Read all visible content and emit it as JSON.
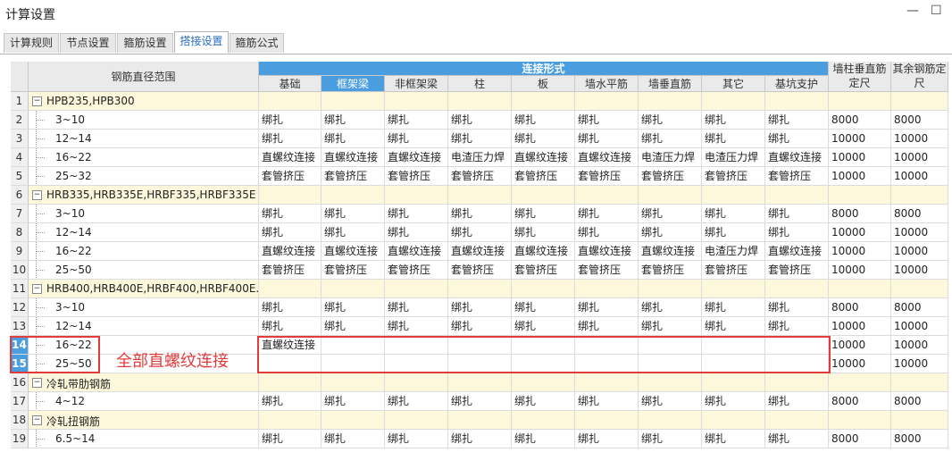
{
  "window": {
    "title": "计算设置",
    "minimize": "—",
    "maximize": "☐"
  },
  "tabs": [
    "计算规则",
    "节点设置",
    "箍筋设置",
    "搭接设置",
    "箍筋公式"
  ],
  "active_tab": 3,
  "header": {
    "range_label": "钢筋直径范围",
    "group_label": "连接形式",
    "columns": [
      "基础",
      "框架梁",
      "非框架梁",
      "柱",
      "板",
      "墙水平筋",
      "墙垂直筋",
      "其它",
      "基坑支护"
    ],
    "wall_col": "墙柱垂直筋定尺",
    "other_col": "其余钢筋定尺"
  },
  "rows": [
    {
      "num": "1",
      "group": true,
      "label": "HPB235,HPB300"
    },
    {
      "num": "2",
      "group": false,
      "label": "3~10",
      "cells": [
        "绑扎",
        "绑扎",
        "绑扎",
        "绑扎",
        "绑扎",
        "绑扎",
        "绑扎",
        "绑扎",
        "绑扎"
      ],
      "len1": "8000",
      "len2": "8000"
    },
    {
      "num": "3",
      "group": false,
      "label": "12~14",
      "cells": [
        "绑扎",
        "绑扎",
        "绑扎",
        "绑扎",
        "绑扎",
        "绑扎",
        "绑扎",
        "绑扎",
        "绑扎"
      ],
      "len1": "10000",
      "len2": "10000"
    },
    {
      "num": "4",
      "group": false,
      "label": "16~22",
      "cells": [
        "直螺纹连接",
        "直螺纹连接",
        "直螺纹连接",
        "电渣压力焊",
        "直螺纹连接",
        "直螺纹连接",
        "电渣压力焊",
        "电渣压力焊",
        "直螺纹连接"
      ],
      "len1": "10000",
      "len2": "10000"
    },
    {
      "num": "5",
      "group": false,
      "label": "25~32",
      "cells": [
        "套管挤压",
        "套管挤压",
        "套管挤压",
        "套管挤压",
        "套管挤压",
        "套管挤压",
        "套管挤压",
        "套管挤压",
        "套管挤压"
      ],
      "len1": "10000",
      "len2": "10000"
    },
    {
      "num": "6",
      "group": true,
      "label": "HRB335,HRB335E,HRBF335,HRBF335E"
    },
    {
      "num": "7",
      "group": false,
      "label": "3~10",
      "cells": [
        "绑扎",
        "绑扎",
        "绑扎",
        "绑扎",
        "绑扎",
        "绑扎",
        "绑扎",
        "绑扎",
        "绑扎"
      ],
      "len1": "8000",
      "len2": "8000"
    },
    {
      "num": "8",
      "group": false,
      "label": "12~14",
      "cells": [
        "绑扎",
        "绑扎",
        "绑扎",
        "绑扎",
        "绑扎",
        "绑扎",
        "绑扎",
        "绑扎",
        "绑扎"
      ],
      "len1": "10000",
      "len2": "10000"
    },
    {
      "num": "9",
      "group": false,
      "label": "16~22",
      "cells": [
        "直螺纹连接",
        "直螺纹连接",
        "直螺纹连接",
        "直螺纹连接",
        "直螺纹连接",
        "直螺纹连接",
        "直螺纹连接",
        "电渣压力焊",
        "直螺纹连接"
      ],
      "len1": "10000",
      "len2": "10000"
    },
    {
      "num": "10",
      "group": false,
      "label": "25~50",
      "cells": [
        "套管挤压",
        "套管挤压",
        "套管挤压",
        "套管挤压",
        "套管挤压",
        "套管挤压",
        "套管挤压",
        "套管挤压",
        "套管挤压"
      ],
      "len1": "10000",
      "len2": "10000"
    },
    {
      "num": "11",
      "group": true,
      "label": "HRB400,HRB400E,HRBF400,HRBF400E..."
    },
    {
      "num": "12",
      "group": false,
      "label": "3~10",
      "cells": [
        "绑扎",
        "绑扎",
        "绑扎",
        "绑扎",
        "绑扎",
        "绑扎",
        "绑扎",
        "绑扎",
        "绑扎"
      ],
      "len1": "8000",
      "len2": "8000"
    },
    {
      "num": "13",
      "group": false,
      "label": "12~14",
      "cells": [
        "绑扎",
        "绑扎",
        "绑扎",
        "绑扎",
        "绑扎",
        "绑扎",
        "绑扎",
        "绑扎",
        "绑扎"
      ],
      "len1": "10000",
      "len2": "10000"
    },
    {
      "num": "14",
      "group": false,
      "selected": true,
      "label": "16~22",
      "cells": [
        "直螺纹连接",
        "",
        "",
        "",
        "",
        "",
        "",
        "",
        ""
      ],
      "len1": "10000",
      "len2": "10000"
    },
    {
      "num": "15",
      "group": false,
      "selected": true,
      "label": "25~50",
      "cells": [
        "",
        "",
        "",
        "",
        "",
        "",
        "",
        "",
        ""
      ],
      "len1": "10000",
      "len2": "10000"
    },
    {
      "num": "16",
      "group": true,
      "label": "冷轧带肋钢筋"
    },
    {
      "num": "17",
      "group": false,
      "label": "4~12",
      "cells": [
        "绑扎",
        "绑扎",
        "绑扎",
        "绑扎",
        "绑扎",
        "绑扎",
        "绑扎",
        "绑扎",
        "绑扎"
      ],
      "len1": "8000",
      "len2": "8000"
    },
    {
      "num": "18",
      "group": true,
      "label": "冷轧扭钢筋"
    },
    {
      "num": "19",
      "group": false,
      "label": "6.5~14",
      "cells": [
        "绑扎",
        "绑扎",
        "绑扎",
        "绑扎",
        "绑扎",
        "绑扎",
        "绑扎",
        "绑扎",
        "绑扎"
      ],
      "len1": "8000",
      "len2": "8000"
    }
  ],
  "annotation": "全部直螺纹连接",
  "colors": {
    "header_blue": "#4a9ee0",
    "group_bg": "#fdf8dc",
    "annotation_red": "#e23b3b"
  }
}
